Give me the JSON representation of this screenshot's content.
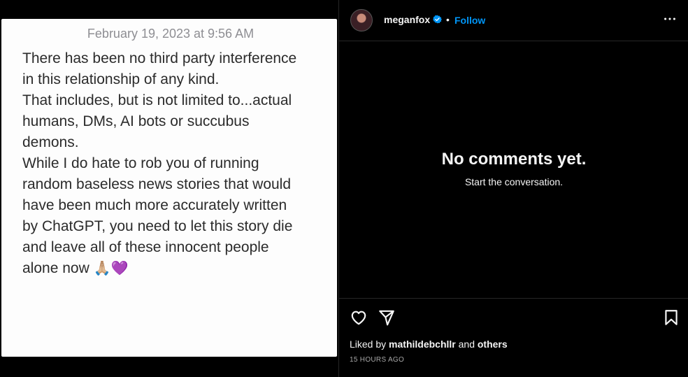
{
  "post": {
    "date": "February 19, 2023 at 9:56 AM",
    "lines": [
      "There has been no third party interference",
      "in this relationship of any kind.",
      "That includes, but is not limited to...actual",
      "humans, DMs, AI bots or succubus",
      "demons.",
      "While I do hate to rob you of running",
      "random baseless news stories that would",
      "have been much more accurately written",
      "by ChatGPT, you need to let this story die",
      "and leave all of these innocent people",
      "alone now "
    ],
    "emoji": "🙏🏼💜"
  },
  "header": {
    "username": "meganfox",
    "separator": "•",
    "follow_label": "Follow",
    "verified_icon": "verified-badge-icon",
    "more_icon": "more-options-icon"
  },
  "comments": {
    "empty_title": "No comments yet.",
    "empty_subtitle": "Start the conversation."
  },
  "footer": {
    "liked_prefix": "Liked by",
    "liked_user": "mathildebchllr",
    "liked_and": "and",
    "liked_others": "others",
    "timestamp": "15 HOURS AGO"
  },
  "colors": {
    "accent": "#0095f6",
    "background": "#000000",
    "note_background": "#fdfdfd"
  }
}
